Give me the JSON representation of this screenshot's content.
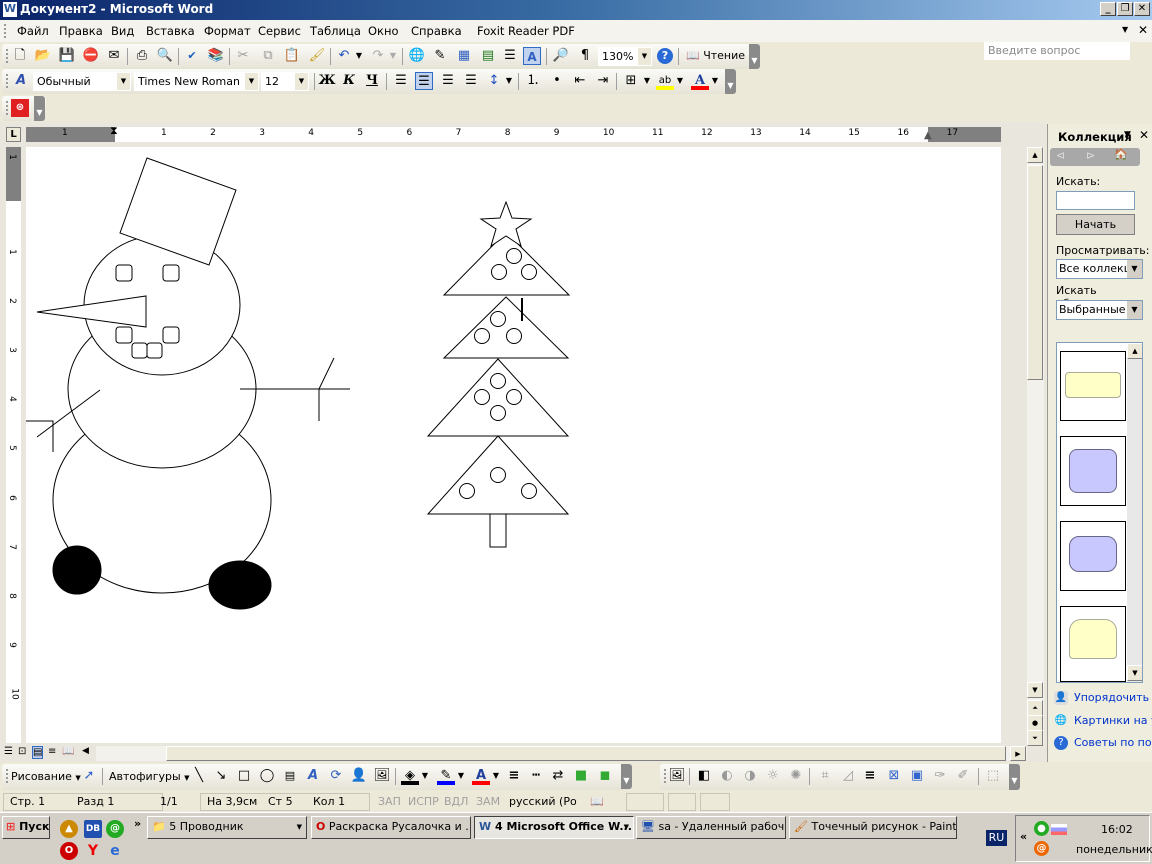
{
  "window": {
    "title": "Документ2 - Microsoft Word",
    "controls": [
      "_",
      "❐",
      "✕"
    ]
  },
  "menu": {
    "items": [
      "Файл",
      "Правка",
      "Вид",
      "Вставка",
      "Формат",
      "Сервис",
      "Таблица",
      "Окно",
      "Справка",
      "Foxit Reader PDF"
    ],
    "ask_placeholder": "Введите вопрос"
  },
  "standard_toolbar": {
    "icons": [
      "new-document-icon",
      "open-icon",
      "save-icon",
      "permission-icon",
      "email-icon",
      "print-icon",
      "print-preview-icon",
      "spelling-icon",
      "research-icon",
      "cut-icon",
      "copy-icon",
      "paste-icon",
      "format-painter-icon",
      "undo-icon",
      "redo-icon",
      "hyperlink-icon",
      "tables-borders-icon",
      "insert-table-icon",
      "insert-excel-icon",
      "columns-icon",
      "drawing-icon",
      "document-map-icon",
      "show-hide-icon",
      "help-icon",
      "reading-icon"
    ],
    "zoom": "130%",
    "reading_label": "Чтение"
  },
  "formatting_toolbar": {
    "style": "Обычный",
    "font": "Times New Roman",
    "size": "12",
    "bold": "Ж",
    "italic": "К",
    "underline": "Ч",
    "active_alignment": "center",
    "highlight_color": "#ffff00",
    "font_color": "#ff0000"
  },
  "ruler": {
    "left_margin_labels": [
      "1"
    ],
    "labels": [
      "1",
      "2",
      "3",
      "4",
      "5",
      "6",
      "7",
      "8",
      "9",
      "10",
      "11",
      "12",
      "13",
      "14",
      "15",
      "16",
      "17"
    ],
    "vertical_top_labels": [
      "1"
    ],
    "vertical_labels": [
      "1",
      "2",
      "3",
      "4",
      "5",
      "6",
      "7",
      "8",
      "9",
      "10"
    ]
  },
  "task_pane": {
    "title": "Коллекция",
    "search_label": "Искать:",
    "search_value": "",
    "go_button": "Начать",
    "browse_label": "Просматривать:",
    "browse_value": "Все коллекции",
    "objects_label": "Искать объекты:",
    "objects_value": "Выбранные т",
    "links": [
      "Упорядочить к",
      "Картинки на у",
      "Советы по пои"
    ]
  },
  "drawing_toolbar": {
    "draw_menu": "Рисование",
    "autoshapes_menu": "Автофигуры",
    "fill_color": "#000000",
    "line_color": "#0000ff",
    "font_color": "#ff0000"
  },
  "status": {
    "page": "Стр. 1",
    "section": "Разд 1",
    "pages": "1/1",
    "at": "На 3,9см",
    "line": "Ст 5",
    "col": "Кол 1",
    "rec": "ЗАП",
    "trk": "ИСПР",
    "ext": "ВДЛ",
    "ovr": "ЗАМ",
    "language": "русский (Ро"
  },
  "taskbar": {
    "start": "Пуск",
    "more": "»",
    "tasks": [
      "5 Проводник",
      "Раскраска Русалочка и ...",
      "4 Microsoft Office W...",
      "sa - Удаленный рабочи...",
      "Точечный рисунок - Paint"
    ],
    "active_task": 2,
    "lang": "RU",
    "tray_expand": "«",
    "time": "16:02",
    "day": "понедельник"
  },
  "colors": {
    "title_start": "#0a246a",
    "title_end": "#a6caf0",
    "link": "#0033cc"
  }
}
